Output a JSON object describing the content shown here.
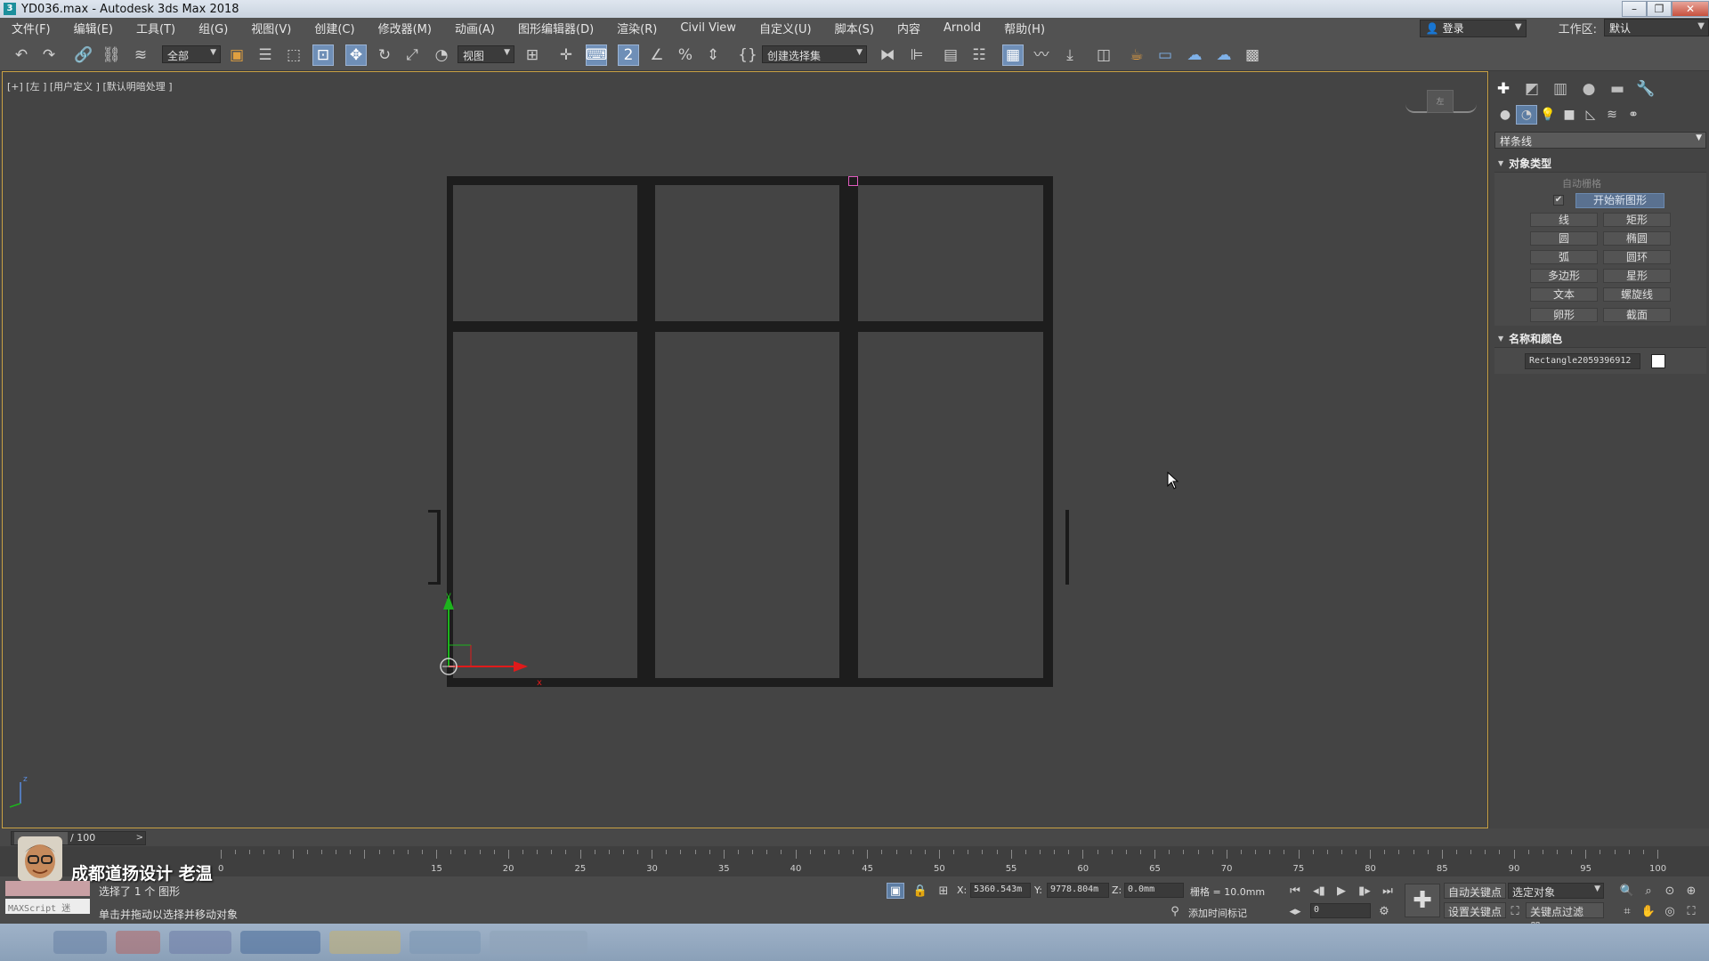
{
  "window": {
    "title": "YD036.max - Autodesk 3ds Max 2018",
    "app_icon": "3",
    "controls": [
      "minimize-icon",
      "maximize-icon",
      "close-icon"
    ]
  },
  "menu": {
    "items": [
      "文件(F)",
      "编辑(E)",
      "工具(T)",
      "组(G)",
      "视图(V)",
      "创建(C)",
      "修改器(M)",
      "动画(A)",
      "图形编辑器(D)",
      "渲染(R)",
      "Civil View",
      "自定义(U)",
      "脚本(S)",
      "内容",
      "Arnold",
      "帮助(H)"
    ],
    "login": "登录",
    "workspace_label": "工作区:",
    "workspace_value": "默认"
  },
  "toolbar": {
    "selection_filter": "全部",
    "ref_coord": "视图",
    "named_selection": "创建选择集"
  },
  "viewport": {
    "label": "[+] [左 ] [用户定义 ] [默认明暗处理 ]",
    "viewcube_face": "左",
    "axis_x": "x",
    "axis_y": "y",
    "axis_z": "z",
    "accent_color": "#caa244",
    "frame_color": "#1d1d1d",
    "gizmo_x_color": "#e01a1a",
    "gizmo_y_color": "#1db31d"
  },
  "command_panel": {
    "category": "样条线",
    "object_type": {
      "title": "对象类型",
      "autogrid": "自动栅格",
      "start_new_shape": "开始新图形",
      "start_new_checked": "✔",
      "buttons": [
        [
          "线",
          "矩形"
        ],
        [
          "圆",
          "椭圆"
        ],
        [
          "弧",
          "圆环"
        ],
        [
          "多边形",
          "星形"
        ],
        [
          "文本",
          "螺旋线"
        ],
        [
          "卵形",
          "截面"
        ]
      ]
    },
    "name_color": {
      "title": "名称和颜色",
      "name": "Rectangle2059396912",
      "color": "#ffffff"
    }
  },
  "timeline": {
    "frame_display": "0 / 100",
    "frame_total": "/ 100",
    "ticks": [
      "0",
      "15",
      "20",
      "25",
      "30",
      "35",
      "40",
      "45",
      "50",
      "55",
      "60",
      "65",
      "70",
      "75",
      "80",
      "85",
      "90",
      "95",
      "100"
    ]
  },
  "status": {
    "studio_name": "成都道扬设计  老温",
    "maxscript": "MAXScript 迷",
    "selected": "选择了 1 个 图形",
    "prompt": "单击并拖动以选择并移动对象",
    "x_label": "X:",
    "x_value": "5360.543m",
    "y_label": "Y:",
    "y_value": "9778.804m",
    "z_label": "Z:",
    "z_value": "0.0mm",
    "grid": "栅格 = 10.0mm",
    "add_time_tag": "添加时间标记",
    "auto_key": "自动关键点",
    "set_key": "设置关键点",
    "selected_object": "选定对象",
    "key_filters": "关键点过滤器...",
    "frame_value": "0"
  }
}
